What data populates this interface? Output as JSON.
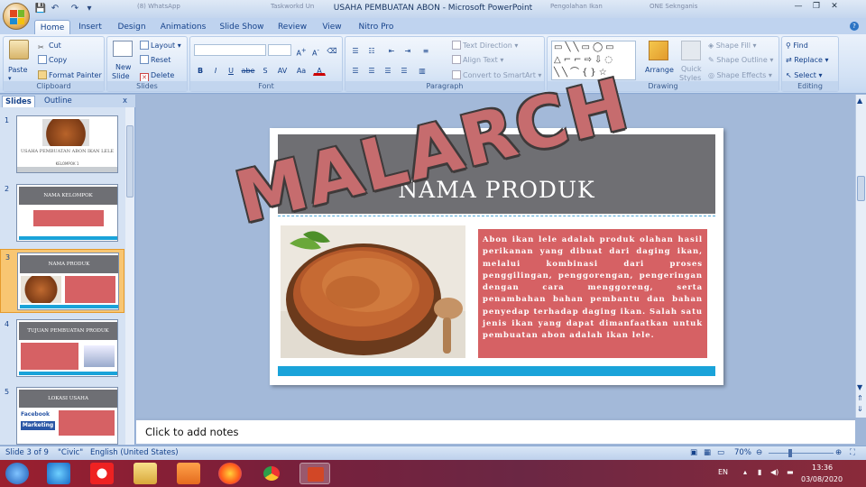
{
  "window": {
    "title": "USAHA PEMBUATAN ABON - Microsoft PowerPoint",
    "bg_tabs": [
      "(8) WhatsApp",
      "Taskworkd Un",
      "Pengolahan Ikan",
      "ONE Seknganis"
    ]
  },
  "tabs": [
    "Home",
    "Insert",
    "Design",
    "Animations",
    "Slide Show",
    "Review",
    "View",
    "Nitro Pro"
  ],
  "ribbon": {
    "clipboard": {
      "label": "Clipboard",
      "paste": "Paste",
      "cut": "Cut",
      "copy": "Copy",
      "format_painter": "Format Painter"
    },
    "slides": {
      "label": "Slides",
      "new_slide": "New",
      "new_slide2": "Slide",
      "layout": "Layout",
      "reset": "Reset",
      "delete": "Delete"
    },
    "font": {
      "label": "Font",
      "buttons": [
        "B",
        "I",
        "U",
        "abe",
        "S",
        "AV",
        "Aa",
        "A"
      ]
    },
    "paragraph": {
      "label": "Paragraph",
      "text_direction": "Text Direction",
      "align_text": "Align Text",
      "convert_smartart": "Convert to SmartArt"
    },
    "drawing": {
      "label": "Drawing",
      "arrange": "Arrange",
      "quick_styles": "Quick",
      "quick_styles2": "Styles",
      "shape_fill": "Shape Fill",
      "shape_outline": "Shape Outline",
      "shape_effects": "Shape Effects"
    },
    "editing": {
      "label": "Editing",
      "find": "Find",
      "replace": "Replace",
      "select": "Select"
    }
  },
  "left_pane": {
    "tabs": [
      "Slides",
      "Outline"
    ],
    "close": "x",
    "thumbnails": [
      {
        "num": "1",
        "title": "USAHA PEMBUATAN ABON IKAN LELE",
        "sub": "KELOMPOK 1"
      },
      {
        "num": "2",
        "title": "NAMA KELOMPOK"
      },
      {
        "num": "3",
        "title": "NAMA PRODUK"
      },
      {
        "num": "4",
        "title": "TUJUAN PEMBUATAN PRODUK"
      },
      {
        "num": "5",
        "title": "LOKASI USAHA",
        "fb": "Facebook",
        "mk": "Marketing"
      }
    ]
  },
  "slide": {
    "title": "NAMA PRODUK",
    "body": "Abon ikan lele adalah produk olahan hasil perikanan yang dibuat dari daging ikan, melalui kombinasi dari proses penggilingan, penggorengan, pengeringan dengan cara menggoreng, serta penambahan bahan pembantu dan bahan penyedap terhadap daging ikan. Salah satu jenis ikan yang dapat dimanfaatkan untuk pembuatan abon adalah ikan lele.",
    "watermark": "MALARCH"
  },
  "notes": {
    "placeholder": "Click to add notes"
  },
  "status": {
    "slide": "Slide 3 of 9",
    "theme": "\"Civic\"",
    "language": "English (United States)",
    "zoom": "70%"
  },
  "taskbar": {
    "lang": "EN",
    "time": "13:36",
    "date": "03/08/2020"
  },
  "colors": {
    "accent": "#1aa3d9",
    "textbox": "#d66164",
    "header": "#6f6f73",
    "watermark": "#c66c6e"
  }
}
